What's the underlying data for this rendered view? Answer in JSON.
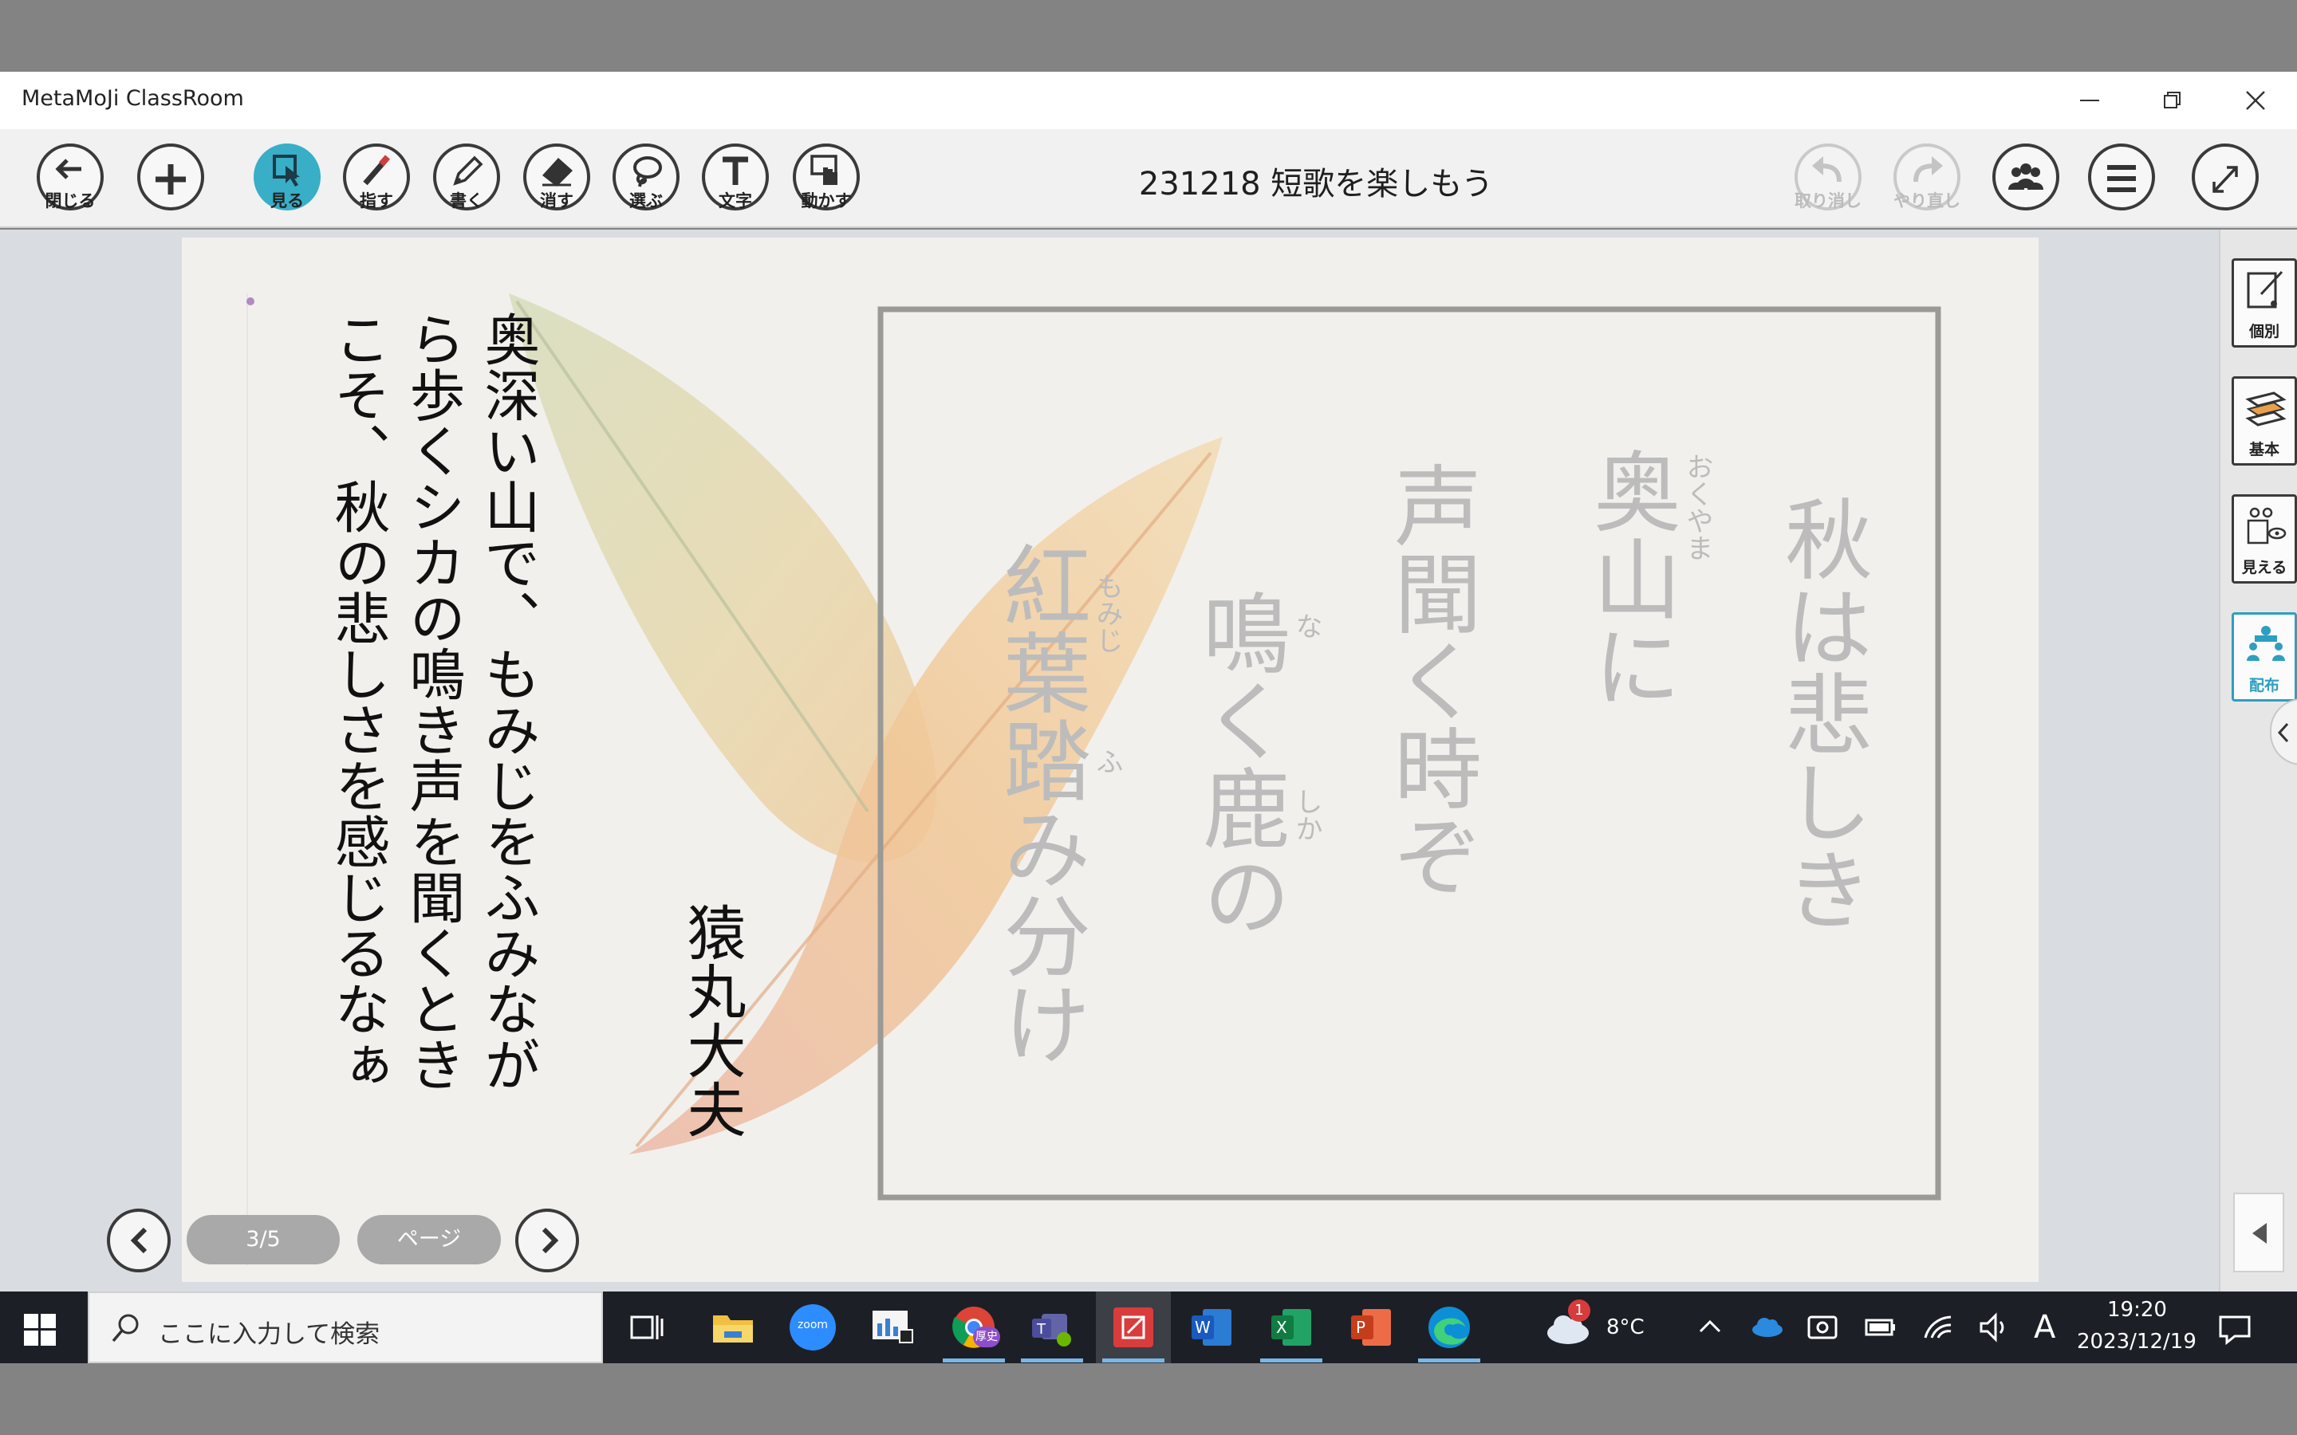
{
  "window": {
    "title": "MetaMoJi ClassRoom"
  },
  "toolbar": {
    "close_label": "閉じる",
    "view_label": "見る",
    "point_label": "指す",
    "write_label": "書く",
    "erase_label": "消す",
    "select_label": "選ぶ",
    "text_label": "文字",
    "move_label": "動かす",
    "undo_label": "取り消し",
    "redo_label": "やり直し",
    "document_title": "231218 短歌を楽しもう"
  },
  "page": {
    "translation_lines": [
      "奥深い山で、もみじをふみなが",
      "ら歩くシカの鳴き声を聞くとき",
      "こそ、秋の悲しさを感じるなぁ"
    ],
    "author": "猿丸大夫",
    "poem_lines": [
      "秋は悲しき",
      "奥山に",
      "声聞く時ぞ",
      "鳴く鹿の",
      "紅葉踏み分け"
    ],
    "ruby": {
      "okuyama": "おくやま",
      "na": "な",
      "shika": "しか",
      "momiji": "もみじ",
      "fu": "ふ"
    }
  },
  "pager": {
    "page_indicator": "3/5",
    "page_button": "ページ"
  },
  "right_panel": {
    "individual": "個別",
    "basic": "基本",
    "visible": "見える",
    "distribute": "配布"
  },
  "taskbar": {
    "search_placeholder": "ここに入力して検索",
    "zoom_label": "zoom",
    "chrome_badge": "厚史",
    "weather_badge": "1",
    "temperature": "8°C",
    "ime": "A",
    "time": "19:20",
    "date": "2023/12/19"
  },
  "colors": {
    "accent": "#39aec7",
    "title_bar": "#ffffff",
    "toolbar": "#f1f1f1",
    "workarea": "#d9dde1",
    "taskbar": "#1d1f26",
    "poem_text": "#bcbcbc"
  }
}
